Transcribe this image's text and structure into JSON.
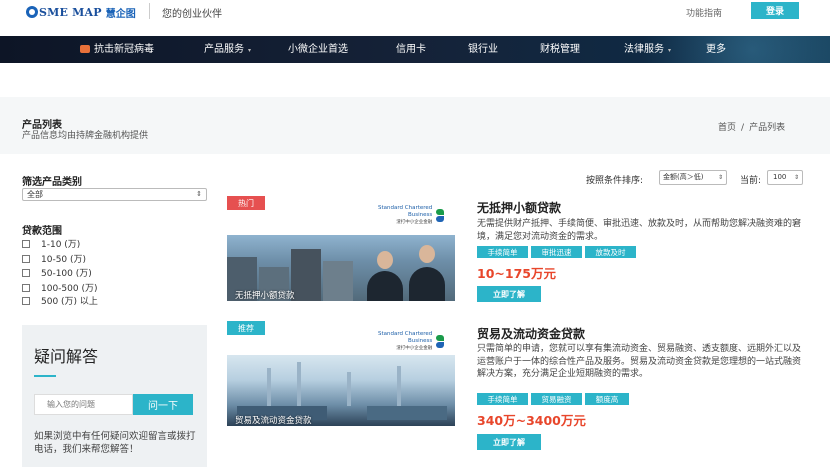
{
  "header": {
    "logo_text": "SME MAP",
    "logo_cn": "慧企图",
    "slogan": "您的创业伙伴",
    "guide_link": "功能指南",
    "login_label": "登录"
  },
  "nav": {
    "items": [
      {
        "label": "抗击新冠病毒",
        "icon": "virus-icon"
      },
      {
        "label": "产品服务",
        "caret": "▾"
      },
      {
        "label": "小微企业首选",
        "caret": ""
      },
      {
        "label": "信用卡",
        "caret": ""
      },
      {
        "label": "银行业",
        "caret": ""
      },
      {
        "label": "财税管理",
        "caret": ""
      },
      {
        "label": "法律服务",
        "caret": "▾"
      },
      {
        "label": "更多",
        "caret": ""
      }
    ]
  },
  "page": {
    "title": "产品列表",
    "subtitle": "产品信息均由持牌金融机构提供",
    "breadcrumb": [
      "首页",
      "/",
      "产品列表"
    ]
  },
  "filters": {
    "category_title": "筛选产品类别",
    "category_value": "全部",
    "loan_title": "贷款范围",
    "ranges": [
      "1-10 (万)",
      "10-50 (万)",
      "50-100 (万)",
      "100-500 (万)",
      "500 (万) 以上"
    ]
  },
  "faq": {
    "title": "疑问解答",
    "input_placeholder": "输入您的问题",
    "ask_label": "问一下",
    "description": "如果浏览中有任何疑问欢迎留言或拨打电话，我们来帮您解答！"
  },
  "sort": {
    "label": "按照条件排序:",
    "value": "金额(高＞低)",
    "current_label": "当前:",
    "page_size": "100"
  },
  "products": [
    {
      "badge": "热门",
      "bank_en_1": "Standard Chartered",
      "bank_en_2": "Business",
      "bank_cn": "渣打中小企业金融",
      "image_caption": "无抵押小额贷款",
      "name": "无抵押小额贷款",
      "description": "无需提供财产抵押、手续简便、审批迅速、放款及时，从而帮助您解决融资难的窘境，满足您对流动资金的需求。",
      "tags": [
        "手续简单",
        "审批迅速",
        "放款及时"
      ],
      "price": "10~175万元",
      "apply_label": "立即了解"
    },
    {
      "badge": "推荐",
      "bank_en_1": "Standard Chartered",
      "bank_en_2": "Business",
      "bank_cn": "渣打中小企业金融",
      "image_caption": "贸易及流动资金贷款",
      "name": "贸易及流动资金贷款",
      "description": "只需简单的申请，您就可以享有集流动资金、贸易融资、透支额度、远期外汇以及运营账户于一体的综合性产品及服务。贸易及流动资金贷款是您理想的一站式融资解决方案，充分满足企业短期融资的需求。",
      "tags": [
        "手续简单",
        "贸易融资",
        "额度高"
      ],
      "price": "340万~3400万元",
      "apply_label": "立即了解"
    }
  ],
  "colors": {
    "accent": "#2cb4c9",
    "hot": "#e65050",
    "price": "#e8462b",
    "nav_bg": "#0d1526"
  }
}
